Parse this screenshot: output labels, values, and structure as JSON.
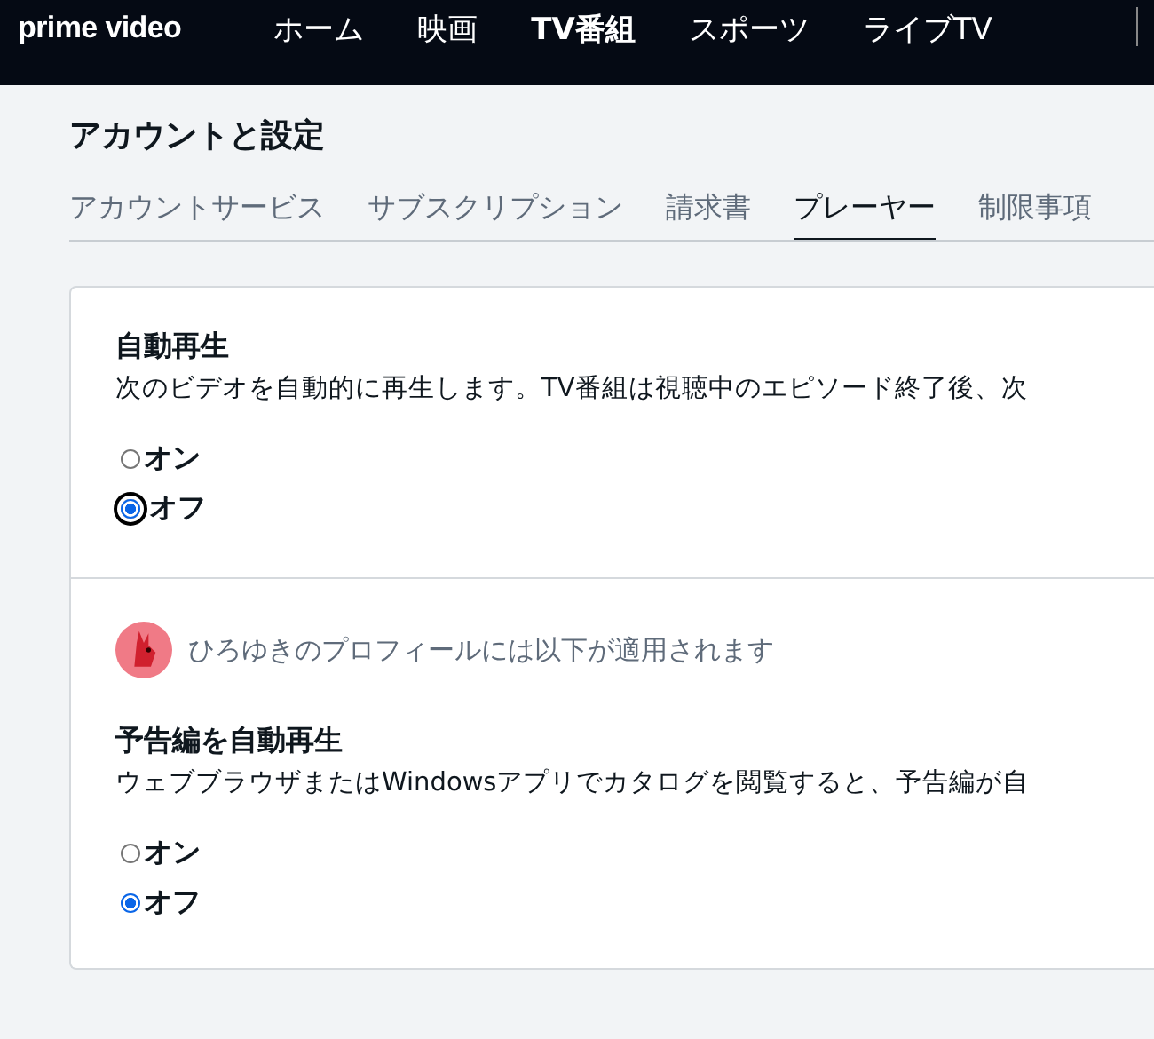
{
  "nav": {
    "logo": "prime video",
    "items": [
      {
        "label": "ホーム",
        "bold": false
      },
      {
        "label": "映画",
        "bold": false
      },
      {
        "label": "TV番組",
        "bold": true
      },
      {
        "label": "スポーツ",
        "bold": false
      },
      {
        "label": "ライブTV",
        "bold": false
      }
    ]
  },
  "page_title": "アカウントと設定",
  "tabs": [
    {
      "label": "アカウントサービス",
      "selected": false
    },
    {
      "label": "サブスクリプション",
      "selected": false
    },
    {
      "label": "請求書",
      "selected": false
    },
    {
      "label": "プレーヤー",
      "selected": true
    },
    {
      "label": "制限事項",
      "selected": false
    }
  ],
  "sections": [
    {
      "heading": "自動再生",
      "description": "次のビデオを自動的に再生します。TV番組は視聴中のエピソード終了後、次",
      "options": [
        {
          "label": "オン",
          "selected": false,
          "focused": false
        },
        {
          "label": "オフ",
          "selected": true,
          "focused": true
        }
      ]
    },
    {
      "profile_note": "ひろゆきのプロフィールには以下が適用されます",
      "heading": "予告編を自動再生",
      "description": "ウェブブラウザまたはWindowsアプリでカタログを閲覧すると、予告編が自",
      "options": [
        {
          "label": "オン",
          "selected": false,
          "focused": false
        },
        {
          "label": "オフ",
          "selected": true,
          "focused": false
        }
      ]
    }
  ]
}
